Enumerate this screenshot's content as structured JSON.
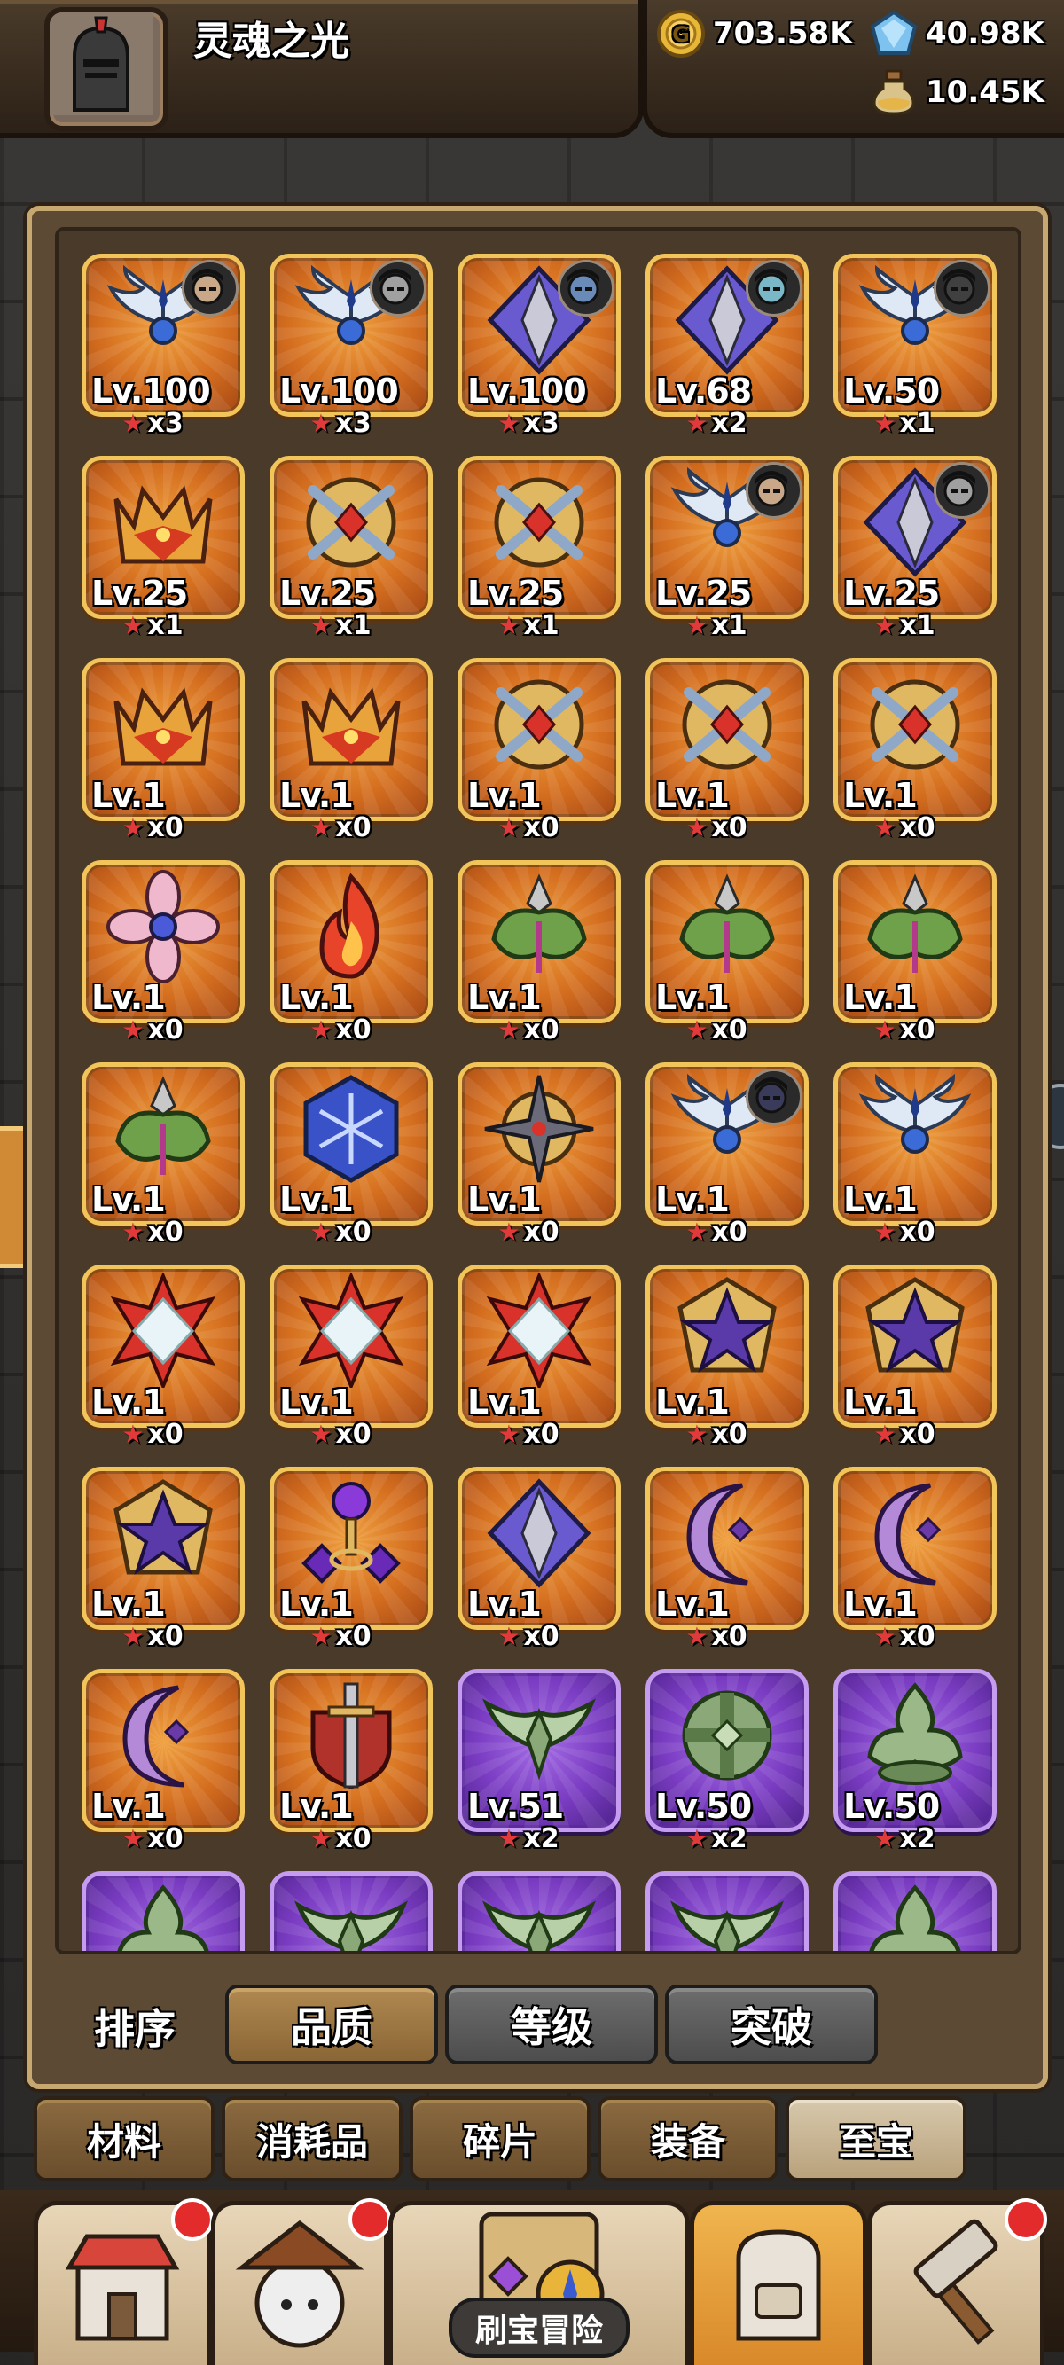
{
  "player": {
    "name": "灵魂之光"
  },
  "currency": {
    "gold": "703.58K",
    "gems": "40.98K",
    "potion": "10.45K"
  },
  "items": [
    {
      "level": "Lv.100",
      "stars": "x3",
      "art": "wing",
      "badge": true
    },
    {
      "level": "Lv.100",
      "stars": "x3",
      "art": "wing",
      "badge": true
    },
    {
      "level": "Lv.100",
      "stars": "x3",
      "art": "spike",
      "badge": true
    },
    {
      "level": "Lv.68",
      "stars": "x2",
      "art": "spike",
      "badge": true
    },
    {
      "level": "Lv.50",
      "stars": "x1",
      "art": "wing",
      "badge": true
    },
    {
      "level": "Lv.25",
      "stars": "x1",
      "art": "flame-crown",
      "badge": false
    },
    {
      "level": "Lv.25",
      "stars": "x1",
      "art": "cross",
      "badge": false
    },
    {
      "level": "Lv.25",
      "stars": "x1",
      "art": "cross",
      "badge": false
    },
    {
      "level": "Lv.25",
      "stars": "x1",
      "art": "wing",
      "badge": true
    },
    {
      "level": "Lv.25",
      "stars": "x1",
      "art": "spike",
      "badge": true
    },
    {
      "level": "Lv.1",
      "stars": "x0",
      "art": "flame-crown",
      "badge": false
    },
    {
      "level": "Lv.1",
      "stars": "x0",
      "art": "flame-crown",
      "badge": false
    },
    {
      "level": "Lv.1",
      "stars": "x0",
      "art": "cross",
      "badge": false
    },
    {
      "level": "Lv.1",
      "stars": "x0",
      "art": "cross",
      "badge": false
    },
    {
      "level": "Lv.1",
      "stars": "x0",
      "art": "cross",
      "badge": false
    },
    {
      "level": "Lv.1",
      "stars": "x0",
      "art": "flower",
      "badge": false
    },
    {
      "level": "Lv.1",
      "stars": "x0",
      "art": "fire",
      "badge": false
    },
    {
      "level": "Lv.1",
      "stars": "x0",
      "art": "leaf",
      "badge": false
    },
    {
      "level": "Lv.1",
      "stars": "x0",
      "art": "leaf",
      "badge": false
    },
    {
      "level": "Lv.1",
      "stars": "x0",
      "art": "leaf",
      "badge": false
    },
    {
      "level": "Lv.1",
      "stars": "x0",
      "art": "leaf",
      "badge": false
    },
    {
      "level": "Lv.1",
      "stars": "x0",
      "art": "snowflake",
      "badge": false
    },
    {
      "level": "Lv.1",
      "stars": "x0",
      "art": "shuriken",
      "badge": false
    },
    {
      "level": "Lv.1",
      "stars": "x0",
      "art": "wing",
      "badge": true
    },
    {
      "level": "Lv.1",
      "stars": "x0",
      "art": "wing",
      "badge": false
    },
    {
      "level": "Lv.1",
      "stars": "x0",
      "art": "diamond-star",
      "badge": false
    },
    {
      "level": "Lv.1",
      "stars": "x0",
      "art": "diamond-star",
      "badge": false
    },
    {
      "level": "Lv.1",
      "stars": "x0",
      "art": "diamond-star",
      "badge": false
    },
    {
      "level": "Lv.1",
      "stars": "x0",
      "art": "pentagram",
      "badge": false
    },
    {
      "level": "Lv.1",
      "stars": "x0",
      "art": "pentagram",
      "badge": false
    },
    {
      "level": "Lv.1",
      "stars": "x0",
      "art": "pentagram",
      "badge": false
    },
    {
      "level": "Lv.1",
      "stars": "x0",
      "art": "orb",
      "badge": false
    },
    {
      "level": "Lv.1",
      "stars": "x0",
      "art": "spike",
      "badge": false
    },
    {
      "level": "Lv.1",
      "stars": "x0",
      "art": "moon",
      "badge": false
    },
    {
      "level": "Lv.1",
      "stars": "x0",
      "art": "moon",
      "badge": false
    },
    {
      "level": "Lv.1",
      "stars": "x0",
      "art": "moon",
      "badge": false
    },
    {
      "level": "Lv.1",
      "stars": "x0",
      "art": "sword-shield",
      "badge": false
    },
    {
      "level": "Lv.51",
      "stars": "x2",
      "art": "green-wing",
      "badge": false,
      "purple": true
    },
    {
      "level": "Lv.50",
      "stars": "x2",
      "art": "green-cross",
      "badge": false,
      "purple": true
    },
    {
      "level": "Lv.50",
      "stars": "x2",
      "art": "green-crown",
      "badge": false,
      "purple": true
    },
    {
      "level": "",
      "stars": "",
      "art": "green-crown",
      "badge": false,
      "purple": true
    },
    {
      "level": "",
      "stars": "",
      "art": "green-wing",
      "badge": false,
      "purple": true
    },
    {
      "level": "",
      "stars": "",
      "art": "green-wing",
      "badge": false,
      "purple": true
    },
    {
      "level": "",
      "stars": "",
      "art": "green-wing",
      "badge": false,
      "purple": true
    },
    {
      "level": "",
      "stars": "",
      "art": "green-crown",
      "badge": false,
      "purple": true
    }
  ],
  "sort": {
    "label": "排序",
    "options": [
      "品质",
      "等级",
      "突破"
    ],
    "active": 0
  },
  "tabs": {
    "items": [
      "材料",
      "消耗品",
      "碎片",
      "装备",
      "至宝"
    ],
    "active": 4
  },
  "nav": {
    "adventure_label": "刷宝冒险"
  },
  "colors": {
    "card_orange": "#d46e1f",
    "card_purple": "#7a3cc2",
    "star_red": "#e23a3a"
  }
}
